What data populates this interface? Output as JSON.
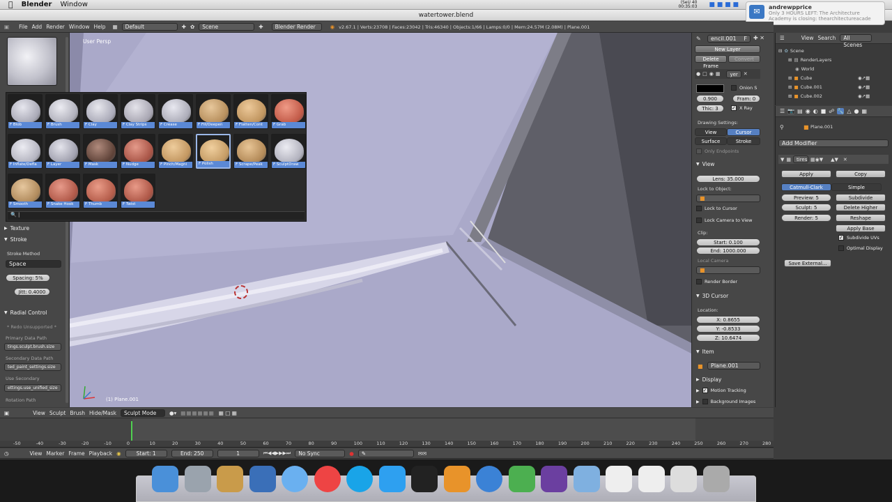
{
  "mac_menu": {
    "apple": "",
    "app": "Blender",
    "window": "Window"
  },
  "clock": {
    "line1": "(SeU 40",
    "line2": "00:35:03"
  },
  "window_title": "watertower.blend",
  "notification": {
    "user": "andrewpprice",
    "line1": "Only 3 HOURS LEFT: The Architecture",
    "line2": "Academy is closing: thearchitectureacade"
  },
  "info_header": {
    "menus": [
      "File",
      "Add",
      "Render",
      "Window",
      "Help"
    ],
    "layout": "Default",
    "scene": "Scene",
    "engine": "Blender Render",
    "stats": "v2.67.1 | Verts:23708 | Faces:23042 | Tris:46340 | Objects:1/66 | Lamps:0/0 | Mem:24.57M (2.08M) | Plane.001"
  },
  "viewport": {
    "label": "User Persp",
    "object_label": "(1) Plane.001"
  },
  "brushes": [
    {
      "name": "F Blob",
      "c1": "#e6e6ee",
      "c2": "#a9a9b6"
    },
    {
      "name": "F Brush",
      "c1": "#ececf2",
      "c2": "#b0b0bb"
    },
    {
      "name": "F Clay",
      "c1": "#e8e8ee",
      "c2": "#aaaab8"
    },
    {
      "name": "F Clay Strips",
      "c1": "#e4e3ea",
      "c2": "#a8a6b2"
    },
    {
      "name": "F Crease",
      "c1": "#e8e8f0",
      "c2": "#acacb8"
    },
    {
      "name": "F Fill/Deepen",
      "c1": "#e7c79b",
      "c2": "#b78f5d"
    },
    {
      "name": "F Flatten/Cont",
      "c1": "#edc99a",
      "c2": "#c0955f"
    },
    {
      "name": "F Grab",
      "c1": "#ef9a86",
      "c2": "#c25a48"
    },
    {
      "name": "F Inflate/Defla",
      "c1": "#ececf2",
      "c2": "#b4b4c0"
    },
    {
      "name": "F Layer",
      "c1": "#e4e4ec",
      "c2": "#a0a0ae"
    },
    {
      "name": "F Mask",
      "c1": "#b08a7c",
      "c2": "#5e4238"
    },
    {
      "name": "F Nudge",
      "c1": "#e49a8a",
      "c2": "#a85446"
    },
    {
      "name": "F Pinch/Magni",
      "c1": "#eecc9c",
      "c2": "#c29660"
    },
    {
      "name": "F Polish",
      "c1": "#f0cf9e",
      "c2": "#c49b64"
    },
    {
      "name": "F Scrape/Peak",
      "c1": "#e8c596",
      "c2": "#b38a58"
    },
    {
      "name": "F SculptDraw",
      "c1": "#ececf2",
      "c2": "#b2b2be"
    },
    {
      "name": "F Smooth",
      "c1": "#e6c79e",
      "c2": "#b08a5c"
    },
    {
      "name": "F Snake Hook",
      "c1": "#e79a8a",
      "c2": "#b05848"
    },
    {
      "name": "F Thumb",
      "c1": "#ea9c88",
      "c2": "#b45c4a"
    },
    {
      "name": "F Twist",
      "c1": "#e89a88",
      "c2": "#ad5646"
    }
  ],
  "tool_panel": {
    "texture": "Texture",
    "stroke": "Stroke",
    "stroke_method_label": "Stroke Method",
    "stroke_method": "Space",
    "spacing": "Spacing: 5%",
    "jitter": "Jitt: 0.4000",
    "radial": "Radial Control",
    "redo": "* Redo Unsupported *",
    "primary_label": "Primary Data Path",
    "primary_value": "tings.sculpt.brush.size",
    "secondary_label": "Secondary Data Path",
    "secondary_value": "ted_paint_settings.size",
    "use_secondary_label": "Use Secondary",
    "use_secondary_value": "ettings.use_unified_size",
    "rotation_label": "Rotation Path"
  },
  "gp_panel": {
    "name": "encil.001",
    "f": "F",
    "new_layer": "New Layer",
    "delete_frame": "Delete Frame",
    "convert": "Convert",
    "layer": "yer",
    "onion": "Onion S",
    "opacity": "0.900",
    "frame": "Fram: 0",
    "thickness": "Thic: 3",
    "xray": "X Ray",
    "drawing_settings": "Drawing Settings:",
    "view": "View",
    "cursor": "Cursor",
    "surface": "Surface",
    "stroke": "Stroke",
    "only_endpoints": "Only Endpoints"
  },
  "view_panel": {
    "title": "View",
    "lens": "Lens: 35.000",
    "lock_object": "Lock to Object:",
    "lock_cursor": "Lock to Cursor",
    "lock_camera": "Lock Camera to View",
    "clip": "Clip:",
    "clip_start": "Start: 0.100",
    "clip_end": "End: 1000.000",
    "local_camera": "Local Camera",
    "render_border": "Render Border"
  },
  "cursor_panel": {
    "title": "3D Cursor",
    "location": "Location:",
    "x": "X: 0.8655",
    "y": "Y: -0.8533",
    "z": "Z: 10.6474"
  },
  "item_panel": {
    "title": "Item",
    "name": "Plane.001"
  },
  "display_panel": {
    "title": "Display"
  },
  "motion_tracking": "Motion Tracking",
  "background_images": "Background Images",
  "outliner": {
    "view": "View",
    "search": "Search",
    "filter": "All Scenes",
    "items": [
      "Scene",
      "RenderLayers",
      "World",
      "Cube",
      "Cube.001",
      "Cube.002"
    ]
  },
  "properties": {
    "object": "Plane.001",
    "add_modifier": "Add Modifier",
    "modifier_name": "tires",
    "apply": "Apply",
    "copy": "Copy",
    "catmull": "Catmull-Clark",
    "simple": "Simple",
    "preview": "Preview: 5",
    "subdivide": "Subdivide",
    "sculpt": "Sculpt: 5",
    "delete_higher": "Delete Higher",
    "render": "Render: 5",
    "reshape": "Reshape",
    "apply_base": "Apply Base",
    "subdivide_uvs": "Subdivide UVs",
    "optimal_display": "Optimal Display",
    "save_external": "Save External..."
  },
  "viewport_header": {
    "menus": [
      "View",
      "Sculpt",
      "Brush",
      "Hide/Mask"
    ],
    "mode": "Sculpt Mode"
  },
  "timeline": {
    "ticks": [
      "-50",
      "-40",
      "-30",
      "-20",
      "-10",
      "0",
      "10",
      "20",
      "30",
      "40",
      "50",
      "60",
      "70",
      "80",
      "90",
      "100",
      "110",
      "120",
      "130",
      "140",
      "150",
      "160",
      "170",
      "180",
      "190",
      "200",
      "210",
      "220",
      "230",
      "240",
      "250",
      "260",
      "270",
      "280"
    ],
    "menus": [
      "View",
      "Marker",
      "Frame",
      "Playback"
    ],
    "start": "Start: 1",
    "end": "End: 250",
    "current": "1",
    "sync": "No Sync",
    "current_frame": 0
  },
  "dock": [
    "finder",
    "launchpad",
    "preview",
    "xcode",
    "messages",
    "chrome",
    "skype",
    "twitter",
    "terminal",
    "blender",
    "qt",
    "check",
    "hd",
    "folder",
    "docs",
    "sheet",
    "apps",
    "trash"
  ]
}
